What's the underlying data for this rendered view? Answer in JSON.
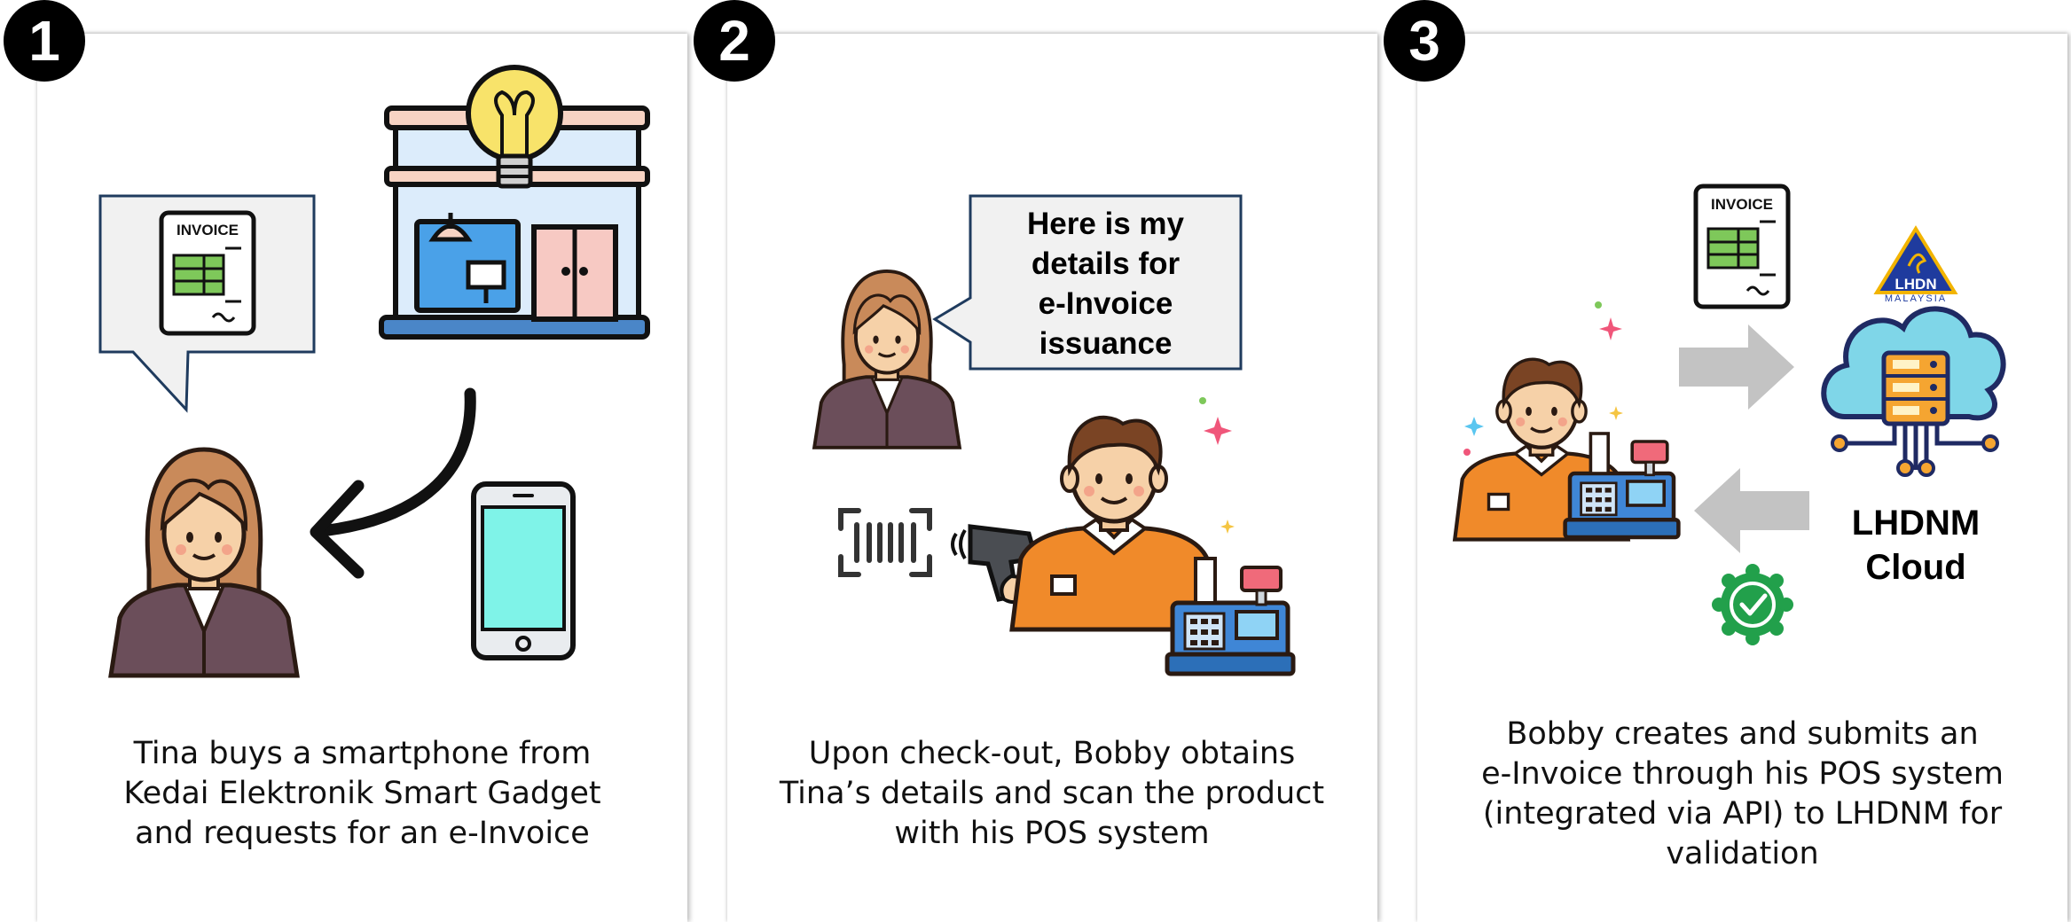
{
  "steps": [
    {
      "number": "1",
      "caption_lines": [
        "Tina buys a smartphone from",
        "Kedai Elektronik Smart Gadget",
        "and requests for an e-Invoice"
      ],
      "invoice_label": "INVOICE"
    },
    {
      "number": "2",
      "caption_lines": [
        "Upon check-out, Bobby obtains",
        "Tina’s details and scan the product",
        "with his POS system"
      ],
      "speech_lines": [
        "Here is my",
        "details for",
        "e-Invoice",
        "issuance"
      ]
    },
    {
      "number": "3",
      "caption_lines": [
        "Bobby creates and submits an",
        "e-Invoice through his POS system",
        "(integrated via API) to LHDNM for",
        "validation"
      ],
      "invoice_label": "INVOICE",
      "logo_text": "LHDN",
      "logo_subtext": "MALAYSIA",
      "cloud_label_lines": [
        "LHDNM",
        "Cloud"
      ]
    }
  ],
  "colors": {
    "badge": "#000000",
    "bubble_fill": "#f1f1f1",
    "bubble_border": "#1f3b5e",
    "arrow_grey": "#c3c3c3",
    "check_green": "#22a04b"
  }
}
